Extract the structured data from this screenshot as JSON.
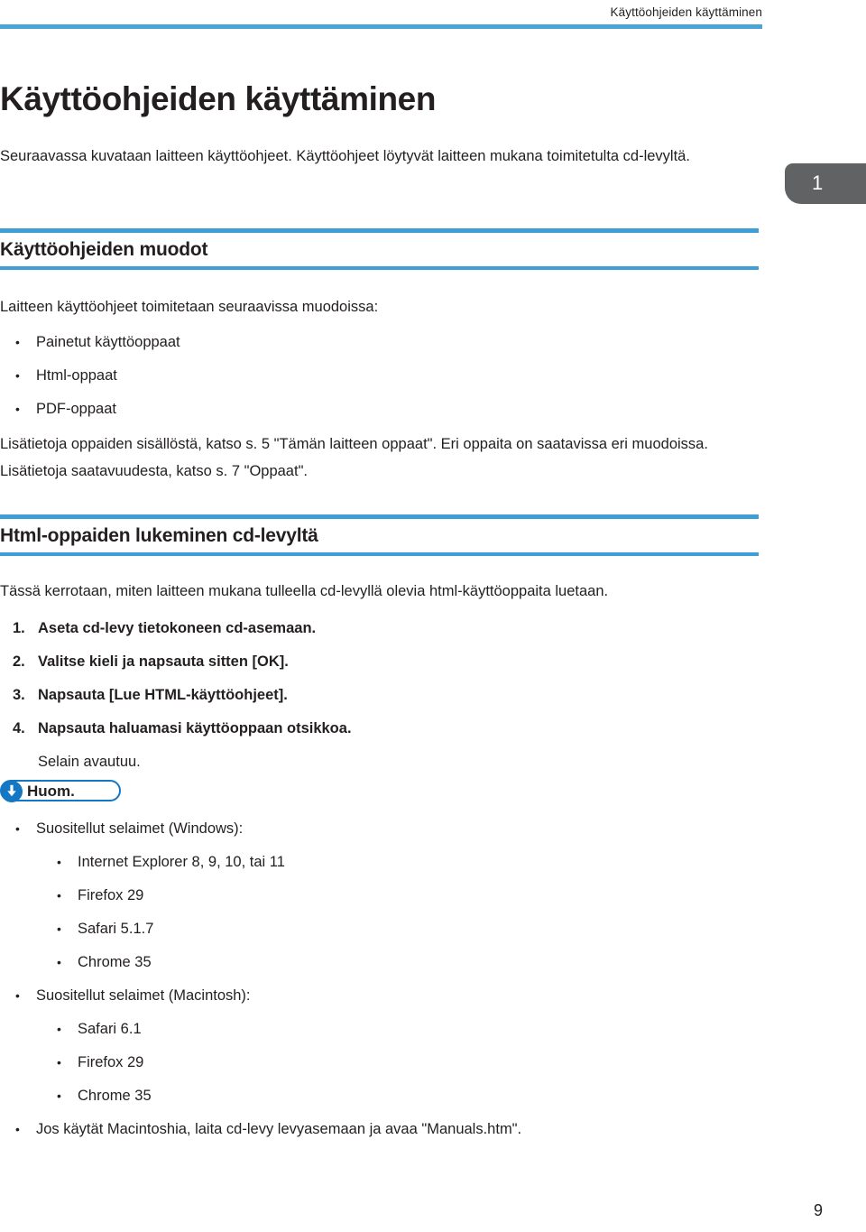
{
  "header": {
    "running_title": "Käyttöohjeiden käyttäminen",
    "rule_color": "#49a5d8"
  },
  "tab_marker": {
    "number": "1",
    "background": "#606264",
    "text_color": "#ffffff"
  },
  "document": {
    "chapter_title": "Käyttöohjeiden käyttäminen",
    "intro": "Seuraavassa kuvataan laitteen käyttöohjeet. Käyttöohjeet löytyvät laitteen mukana toimitetulta cd-levyltä."
  },
  "section_formats": {
    "title": "Käyttöohjeiden muodot",
    "lead": "Laitteen käyttöohjeet toimitetaan seuraavissa muodoissa:",
    "bullets": [
      "Painetut käyttöoppaat",
      "Html-oppaat",
      "PDF-oppaat"
    ],
    "closing": "Lisätietoja oppaiden sisällöstä, katso s. 5 \"Tämän laitteen oppaat\". Eri oppaita on saatavissa eri muodoissa. Lisätietoja saatavuudesta, katso s. 7 \"Oppaat\"."
  },
  "section_html": {
    "title": "Html-oppaiden lukeminen cd-levyltä",
    "lead": "Tässä kerrotaan, miten laitteen mukana tulleella cd-levyllä olevia html-käyttöoppaita luetaan.",
    "steps": [
      {
        "number": "1.",
        "text": "Aseta cd-levy tietokoneen cd-asemaan."
      },
      {
        "number": "2.",
        "text": "Valitse kieli ja napsauta sitten [OK]."
      },
      {
        "number": "3.",
        "text": "Napsauta [Lue HTML-käyttöohjeet]."
      },
      {
        "number": "4.",
        "text": "Napsauta haluamasi käyttöoppaan otsikkoa."
      }
    ],
    "step_result": "Selain avautuu."
  },
  "note": {
    "label": "Huom.",
    "icon": "down-arrow-icon",
    "accent_color": "#1477c4",
    "items": [
      {
        "level": 1,
        "text": "Suositellut selaimet (Windows):"
      },
      {
        "level": 2,
        "text": "Internet Explorer 8, 9, 10, tai 11"
      },
      {
        "level": 2,
        "text": "Firefox 29"
      },
      {
        "level": 2,
        "text": "Safari 5.1.7"
      },
      {
        "level": 2,
        "text": "Chrome 35"
      },
      {
        "level": 1,
        "text": "Suositellut selaimet (Macintosh):"
      },
      {
        "level": 2,
        "text": "Safari 6.1"
      },
      {
        "level": 2,
        "text": "Firefox 29"
      },
      {
        "level": 2,
        "text": "Chrome 35"
      },
      {
        "level": 1,
        "text": "Jos käytät Macintoshia, laita cd-levy levyasemaan ja avaa \"Manuals.htm\"."
      }
    ]
  },
  "footer": {
    "page_number": "9"
  },
  "bullet_glyph": "•"
}
